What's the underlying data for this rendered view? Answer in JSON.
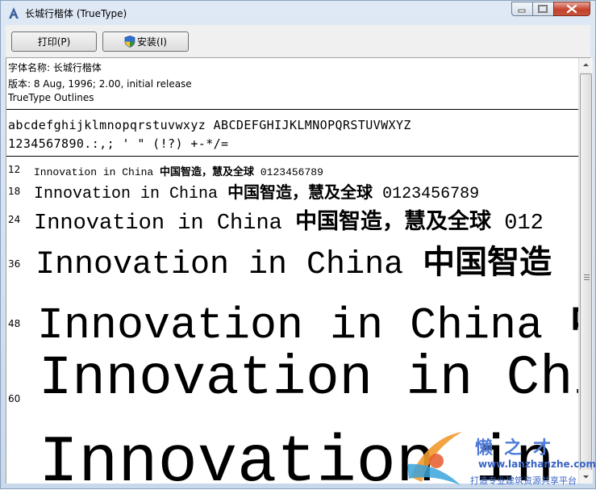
{
  "window": {
    "title": "长城行楷体 (TrueType)"
  },
  "toolbar": {
    "print_label": "打印(P)",
    "install_label": "安装(I)"
  },
  "font_info": {
    "name_line": "字体名称: 长城行楷体",
    "version_line": "版本: 8 Aug, 1996; 2.00, initial release",
    "outline_line": "TrueType Outlines"
  },
  "charset": {
    "letters": "abcdefghijklmnopqrstuvwxyz ABCDEFGHIJKLMNOPQRSTUVWXYZ",
    "digits": "1234567890.:,; ' \" (!?) +-*/="
  },
  "samples": [
    {
      "size": "12",
      "latin": "Innovation in China",
      "chinese": "中国智造，慧及全球",
      "digits": "0123456789"
    },
    {
      "size": "18",
      "latin": "Innovation in China",
      "chinese": "中国智造，慧及全球",
      "digits": "0123456789"
    },
    {
      "size": "24",
      "latin": "Innovation in China",
      "chinese": "中国智造，慧及全球",
      "digits": "012"
    },
    {
      "size": "36",
      "latin": "Innovation in China",
      "chinese": "中国智造",
      "digits": ""
    },
    {
      "size": "48",
      "latin": "Innovation in China",
      "chinese": "中",
      "digits": ""
    },
    {
      "size": "60",
      "latin": "Innovation in Chi",
      "chinese": "",
      "digits": ""
    },
    {
      "size": "",
      "latin": "Innovation in",
      "chinese": "",
      "digits": ""
    }
  ],
  "watermark": {
    "title": "懒之才",
    "url": "www.lanzhanzhe.com",
    "slogan": "打造专业建筑资源共享平台"
  },
  "colors": {
    "titlebar": "#dfe9f5",
    "close_button": "#c5422c",
    "watermark_blue": "#4f7bd8"
  },
  "icons": {
    "title": "font-file-icon",
    "install": "uac-shield-icon"
  }
}
